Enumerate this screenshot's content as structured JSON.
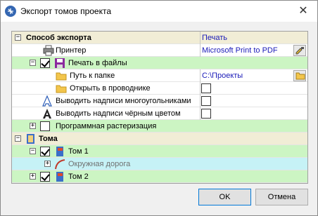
{
  "window": {
    "title": "Экспорт томов проекта"
  },
  "grid": {
    "rows": [
      {
        "label": "Способ экспорта",
        "value": "Печать"
      },
      {
        "label": "Принтер",
        "value": "Microsoft Print to PDF"
      },
      {
        "label": "Печать в файлы"
      },
      {
        "label": "Путь к папке",
        "value": "C:\\Проекты"
      },
      {
        "label": "Открыть в проводнике"
      },
      {
        "label": "Выводить надписи многоугольниками"
      },
      {
        "label": "Выводить надписи чёрным цветом"
      },
      {
        "label": "Программная растеризация"
      },
      {
        "label": "Тома"
      },
      {
        "label": "Том 1"
      },
      {
        "label": "Окружная дорога"
      },
      {
        "label": "Том 2"
      }
    ]
  },
  "buttons": {
    "ok": "OK",
    "cancel": "Отмена"
  },
  "colors": {
    "category": "#f1edd6",
    "checked_row": "#ccf5c3",
    "road_row": "#c6f2f6",
    "value_text": "#1a1ab8"
  }
}
